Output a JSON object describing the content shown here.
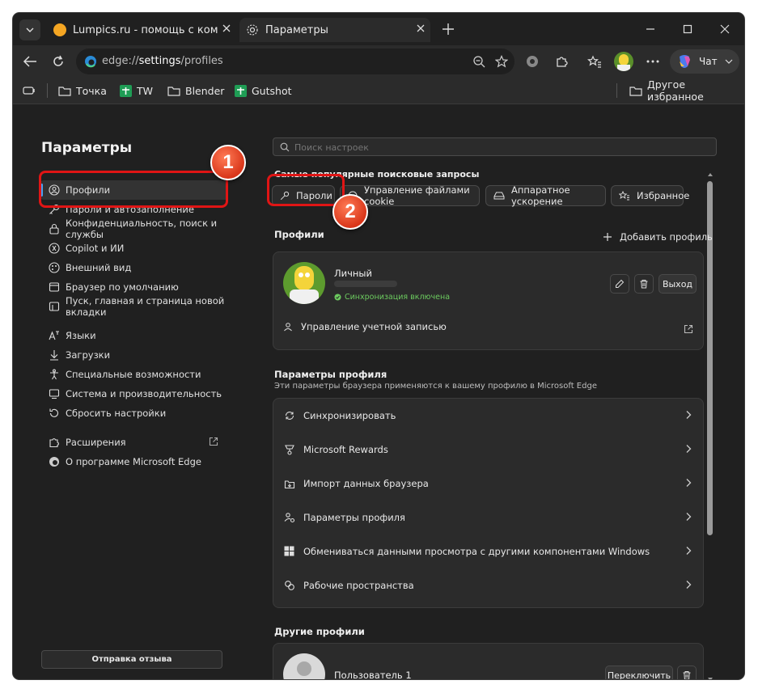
{
  "tabs": [
    {
      "label": "Lumpics.ru - помощь с компьюте",
      "active": false
    },
    {
      "label": "Параметры",
      "active": true
    }
  ],
  "address": {
    "scheme": "edge://",
    "host": "settings",
    "path": "/profiles"
  },
  "toolbar": {
    "chat_label": "Чат"
  },
  "favorites": {
    "items": [
      "Точка",
      "TW",
      "Blender",
      "Gutshot"
    ],
    "other": "Другое избранное"
  },
  "sidebar": {
    "title": "Параметры",
    "items": [
      {
        "label": "Профили",
        "icon": "profile-icon"
      },
      {
        "label": "Пароли и автозаполнение",
        "icon": "key-icon"
      },
      {
        "label": "Конфиденциальность, поиск и службы",
        "icon": "lock-icon"
      },
      {
        "label": "Copilot и ИИ",
        "icon": "copilot-icon"
      },
      {
        "label": "Внешний вид",
        "icon": "appearance-icon"
      },
      {
        "label": "Браузер по умолчанию",
        "icon": "browser-icon"
      },
      {
        "label": "Пуск, главная и страница новой вкладки",
        "icon": "home-icon"
      },
      {
        "label": "Языки",
        "icon": "language-icon"
      },
      {
        "label": "Загрузки",
        "icon": "download-icon"
      },
      {
        "label": "Специальные возможности",
        "icon": "accessibility-icon"
      },
      {
        "label": "Система и производительность",
        "icon": "system-icon"
      },
      {
        "label": "Сбросить настройки",
        "icon": "reset-icon"
      },
      {
        "label": "Расширения",
        "icon": "extensions-icon"
      },
      {
        "label": "О программе Microsoft Edge",
        "icon": "edge-icon"
      }
    ],
    "feedback": "Отправка отзыва"
  },
  "search": {
    "placeholder": "Поиск настроек"
  },
  "popular": {
    "title": "Самые популярные поисковые запросы",
    "chips": [
      "Пароли",
      "Управление файлами cookie",
      "Аппаратное ускорение",
      "Избранное"
    ]
  },
  "profiles": {
    "title": "Профили",
    "add": "Добавить профиль",
    "name": "Личный",
    "sync_status": "Синхронизация включена",
    "logout": "Выход",
    "manage_account": "Управление учетной записью"
  },
  "profile_settings": {
    "title": "Параметры профиля",
    "subtitle": "Эти параметры браузера применяются к вашему профилю в Microsoft Edge",
    "rows": [
      "Синхронизировать",
      "Microsoft Rewards",
      "Импорт данных браузера",
      "Параметры профиля",
      "Обмениваться данными просмотра с другими компонентами Windows",
      "Рабочие пространства"
    ]
  },
  "other_profiles": {
    "title": "Другие профили",
    "user": "Пользователь 1",
    "switch": "Переключить"
  },
  "annotations": [
    "1",
    "2"
  ],
  "colors": {
    "accent": "#e01515",
    "sync_green": "#6ccb5f",
    "bg": "#202020",
    "card": "#2b2b2b"
  }
}
